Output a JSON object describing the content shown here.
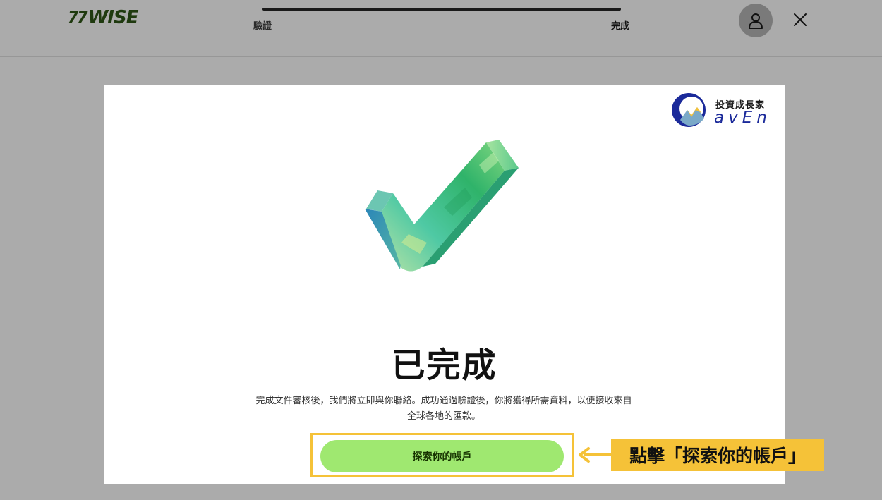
{
  "header": {
    "logo_flag": "77",
    "logo_text": "WISE",
    "steps": [
      {
        "label": "驗證"
      },
      {
        "label": "完成"
      }
    ]
  },
  "card": {
    "watermark": {
      "line1": "投資成長家",
      "line2": "avEn"
    },
    "title": "已完成",
    "description": "完成文件審核後，我們將立即與你聯絡。成功通過驗證後，你將獲得所需資料，以便接收來自全球各地的匯款。",
    "explore_button": "探索你的帳戶"
  },
  "annotation": {
    "callout": "點擊「探索你的帳戶」"
  },
  "colors": {
    "backdrop": "#ababab",
    "card": "#ffffff",
    "button": "#9fe870",
    "button_text": "#163300",
    "highlight": "#f5c238",
    "watermark_blue": "#1b2a9a"
  },
  "icons": {
    "avatar": "user-icon",
    "close": "close-icon",
    "check": "checkmark-graphic",
    "arrow": "arrow-left-icon"
  }
}
